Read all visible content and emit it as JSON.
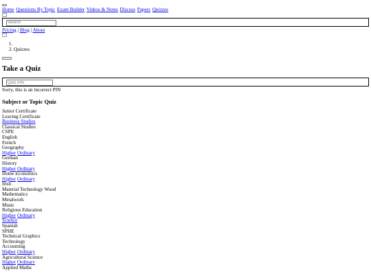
{
  "nav": {
    "links": [
      "Home",
      "Questions By Topic",
      "Exam Builder",
      "Videos & Notes",
      "Discuss",
      "Papers",
      "Quizzes"
    ]
  },
  "search": {
    "placeholder": "Search"
  },
  "secondary_nav": {
    "links": [
      "Pricing",
      "Blog",
      "About"
    ],
    "separator": "|"
  },
  "breadcrumb": {
    "items": [
      "",
      "Quizzes"
    ]
  },
  "main": {
    "title": "Take a Quiz",
    "pin_placeholder": "Quiz PIN",
    "error": "Sorry, this is an incorrect PIN",
    "section_title": "Subject or Topic Quiz"
  },
  "subjects": [
    {
      "text": "Junior Certificate",
      "links": []
    },
    {
      "text": "Leaving Certificate",
      "links": []
    },
    {
      "text": "",
      "links": [
        "Business Studies"
      ]
    },
    {
      "text": "Classical Studies",
      "links": []
    },
    {
      "text": "CSPE",
      "links": []
    },
    {
      "text": "English",
      "links": []
    },
    {
      "text": "French",
      "links": []
    },
    {
      "text": "Geography",
      "links": []
    },
    {
      "text": "",
      "links": [
        "Higher",
        "Ordinary"
      ]
    },
    {
      "text": "German",
      "links": []
    },
    {
      "text": "History",
      "links": []
    },
    {
      "text": "",
      "links": [
        "Higher",
        "Ordinary"
      ]
    },
    {
      "text": "Home Economics",
      "links": []
    },
    {
      "text": "",
      "links": [
        "Higher",
        "Ordinary"
      ]
    },
    {
      "text": "Irish",
      "links": []
    },
    {
      "text": "Material Technology Wood",
      "links": []
    },
    {
      "text": "Mathematics",
      "links": []
    },
    {
      "text": "Metalwork",
      "links": []
    },
    {
      "text": "Music",
      "links": []
    },
    {
      "text": "Religious Education",
      "links": []
    },
    {
      "text": "",
      "links": [
        "Higher",
        "Ordinary"
      ]
    },
    {
      "text": "",
      "links": [
        "Science"
      ]
    },
    {
      "text": "Spanish",
      "links": []
    },
    {
      "text": "SPHE",
      "links": []
    },
    {
      "text": "Technical Graphics",
      "links": []
    },
    {
      "text": "Technology",
      "links": []
    },
    {
      "text": "Accounting",
      "links": []
    },
    {
      "text": "",
      "links": [
        "Higher",
        "Ordinary"
      ]
    },
    {
      "text": "Agricultural Science",
      "links": []
    },
    {
      "text": "",
      "links": [
        "Higher",
        "Ordinary"
      ]
    },
    {
      "text": "Applied Maths",
      "links": []
    }
  ]
}
